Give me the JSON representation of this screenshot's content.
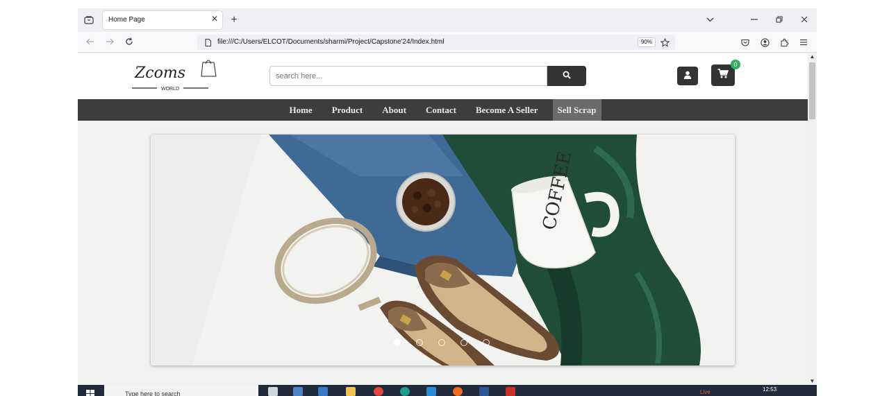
{
  "browser": {
    "tab_title": "Home Page",
    "url": "file:///C:/Users/ELCOT/Documents/sharmi/Project/Capstone'24/Index.html",
    "zoom": "90%"
  },
  "site": {
    "logo": {
      "script_text": "Zcoms",
      "sub_text": "WORLD"
    },
    "search_placeholder": "search here...",
    "cart_count": "0",
    "menu": [
      {
        "label": "Home"
      },
      {
        "label": "Product"
      },
      {
        "label": "About"
      },
      {
        "label": "Contact"
      },
      {
        "label": "Become A Seller"
      },
      {
        "label": "Sell Scrap"
      }
    ],
    "hero": {
      "mug_text": "COFFEE",
      "slide_count": 5,
      "active_slide": 1
    }
  },
  "taskbar": {
    "search_placeholder": "Type here to search",
    "live_label": "Live",
    "time": "12:53"
  },
  "colors": {
    "nav_bg": "#3d3d3d",
    "active_menu_bg": "#6b6b6b",
    "button_dark": "#333333",
    "badge_green": "#2fae5b"
  }
}
